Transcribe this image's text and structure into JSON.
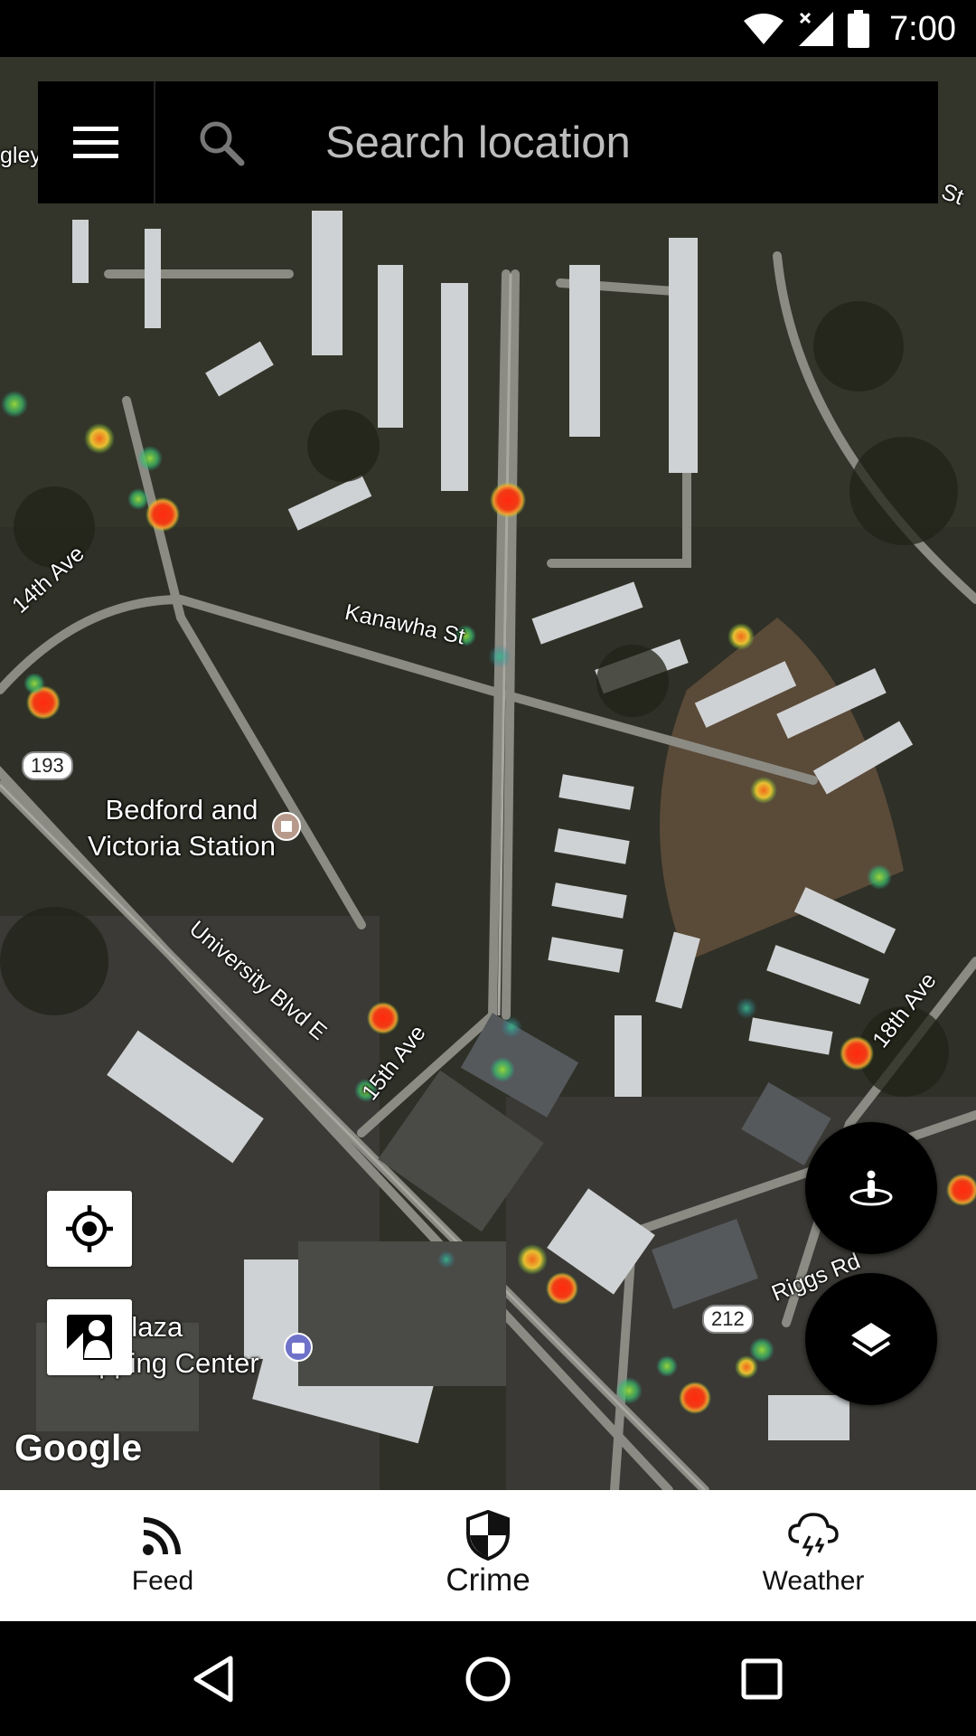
{
  "status_bar": {
    "time": "7:00",
    "icons": [
      "wifi-icon",
      "signal-icon",
      "battery-icon"
    ]
  },
  "search": {
    "placeholder": "Search location",
    "value": ""
  },
  "map": {
    "labels": {
      "poi_station": "Bedford and\nVictoria Station",
      "poi_plaza": "nger Plaza\nShopping Center",
      "road_kanawha": "Kanawha St",
      "road_14th": "14th Ave",
      "road_15th": "15th Ave",
      "road_18th": "18th Ave",
      "road_university": "University Blvd E",
      "road_riggs": "Riggs Rd",
      "road_edge_left": "gley Wa",
      "road_edge_right": "St",
      "shield_193": "193",
      "shield_212": "212"
    },
    "attribution": "Google",
    "heatmap_colors": {
      "hot": "#e8321a",
      "warm": "#f39a2a",
      "cool": "#9acd32",
      "cold": "#2aa88a"
    }
  },
  "map_controls": {
    "my_location": "my-location-icon",
    "street_view": "street-view-icon",
    "pegman_fab": "pegman-icon",
    "layers_fab": "layers-icon"
  },
  "bottom_nav": {
    "items": [
      {
        "label": "Feed",
        "icon": "rss-feed-icon"
      },
      {
        "label": "Crime",
        "icon": "shield-icon",
        "active": true
      },
      {
        "label": "Weather",
        "icon": "thunderstorm-icon"
      }
    ]
  },
  "system_nav": [
    "back-icon",
    "home-icon",
    "recents-icon"
  ]
}
